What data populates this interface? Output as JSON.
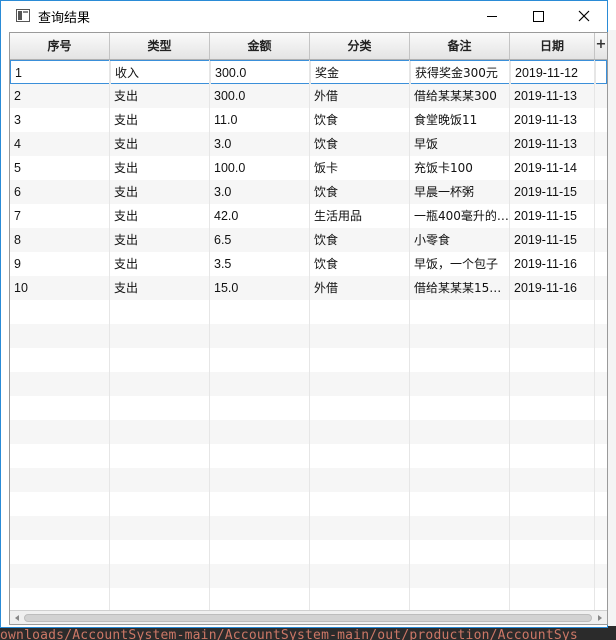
{
  "window": {
    "title": "查询结果"
  },
  "table": {
    "columns": [
      "序号",
      "类型",
      "金额",
      "分类",
      "备注",
      "日期"
    ],
    "add_column_glyph": "+",
    "rows": [
      [
        "1",
        "收入",
        "300.0",
        "奖金",
        "获得奖金300元",
        "2019-11-12"
      ],
      [
        "2",
        "支出",
        "300.0",
        "外借",
        "借给某某某300",
        "2019-11-13"
      ],
      [
        "3",
        "支出",
        "11.0",
        "饮食",
        "食堂晚饭11",
        "2019-11-13"
      ],
      [
        "4",
        "支出",
        "3.0",
        "饮食",
        "早饭",
        "2019-11-13"
      ],
      [
        "5",
        "支出",
        "100.0",
        "饭卡",
        "充饭卡100",
        "2019-11-14"
      ],
      [
        "6",
        "支出",
        "3.0",
        "饮食",
        "早晨一杯粥",
        "2019-11-15"
      ],
      [
        "7",
        "支出",
        "42.0",
        "生活用品",
        "一瓶400毫升的…",
        "2019-11-15"
      ],
      [
        "8",
        "支出",
        "6.5",
        "饮食",
        "小零食",
        "2019-11-15"
      ],
      [
        "9",
        "支出",
        "3.5",
        "饮食",
        "早饭，一个包子",
        "2019-11-16"
      ],
      [
        "10",
        "支出",
        "15.0",
        "外借",
        "借给某某某15…",
        "2019-11-16"
      ]
    ],
    "selected_row": 0
  },
  "background": {
    "path_text": "ownloads/AccountSystem-main/AccountSystem-main/out/production/AccountSys"
  }
}
